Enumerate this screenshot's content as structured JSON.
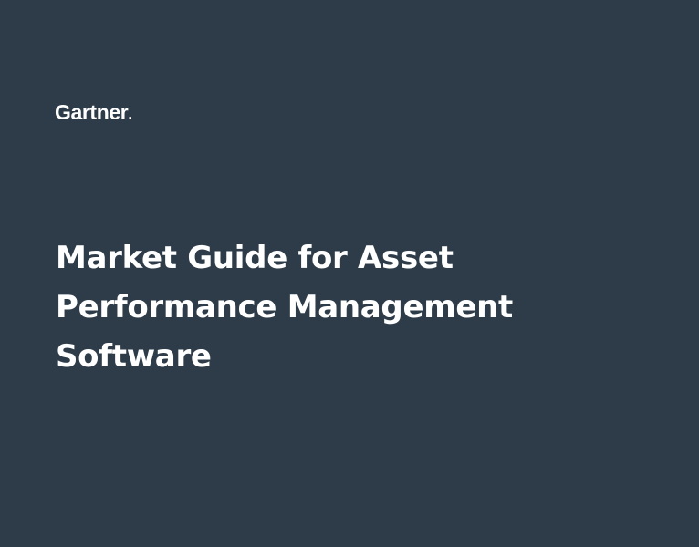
{
  "brand": {
    "name": "Gartner",
    "mark": "."
  },
  "title": {
    "lines": [
      "Market Guide for Asset",
      "Performance Management",
      "Software"
    ]
  },
  "colors": {
    "background": "#2e3c49",
    "text": "#ffffff"
  }
}
